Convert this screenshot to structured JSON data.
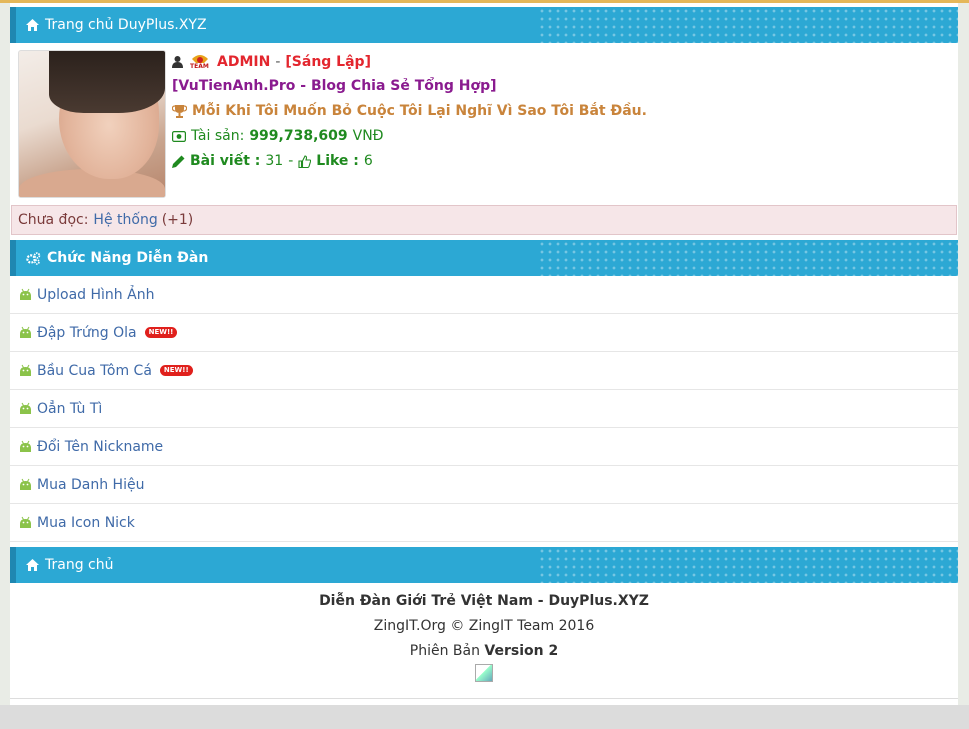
{
  "header": {
    "title": "Trang chủ DuyPlus.XYZ",
    "icon": "home-icon"
  },
  "profile": {
    "username": "ADMIN",
    "separator": "-",
    "role": "[Sáng Lập]",
    "team_badge": "TEAM",
    "blog": "[VuTienAnh.Pro - Blog Chia Sẻ Tổng Hợp]",
    "quote": "Mỗi Khi Tôi Muốn Bỏ Cuộc Tôi Lại Nghĩ Vì Sao Tôi Bắt Đầu.",
    "assets_label": "Tài sản:",
    "assets_value": "999,738,609",
    "assets_unit": "VNĐ",
    "posts_label": "Bài viết :",
    "posts_value": "31",
    "dash": "-",
    "likes_label": "Like :",
    "likes_value": "6"
  },
  "unread": {
    "label": "Chưa đọc:",
    "link": "Hệ thống",
    "count": "(+1)"
  },
  "features": {
    "title": "Chức Năng Diễn Đàn",
    "new_badge": "NEW!!",
    "items": [
      {
        "label": "Upload Hình Ảnh",
        "new": false
      },
      {
        "label": "Đập Trứng Ola",
        "new": true
      },
      {
        "label": "Bầu Cua Tôm Cá",
        "new": true
      },
      {
        "label": "Oẳn Tù Tì",
        "new": false
      },
      {
        "label": "Đổi Tên Nickname",
        "new": false
      },
      {
        "label": "Mua Danh Hiệu",
        "new": false
      },
      {
        "label": "Mua Icon Nick",
        "new": false
      }
    ]
  },
  "home_bar": {
    "label": "Trang chủ"
  },
  "footer": {
    "site": "Diễn Đàn Giới Trẻ Việt Nam - DuyPlus.XYZ",
    "copyright": "ZingIT.Org © ZingIT Team 2016",
    "version_label": "Phiên Bản",
    "version_value": "Version 2"
  },
  "colors": {
    "bar": "#2ca8d4",
    "link": "#3f6aa8",
    "admin": "#e3262e",
    "green": "#1f8a1f",
    "purple": "#8a1b8f",
    "gold": "#c9843b"
  }
}
